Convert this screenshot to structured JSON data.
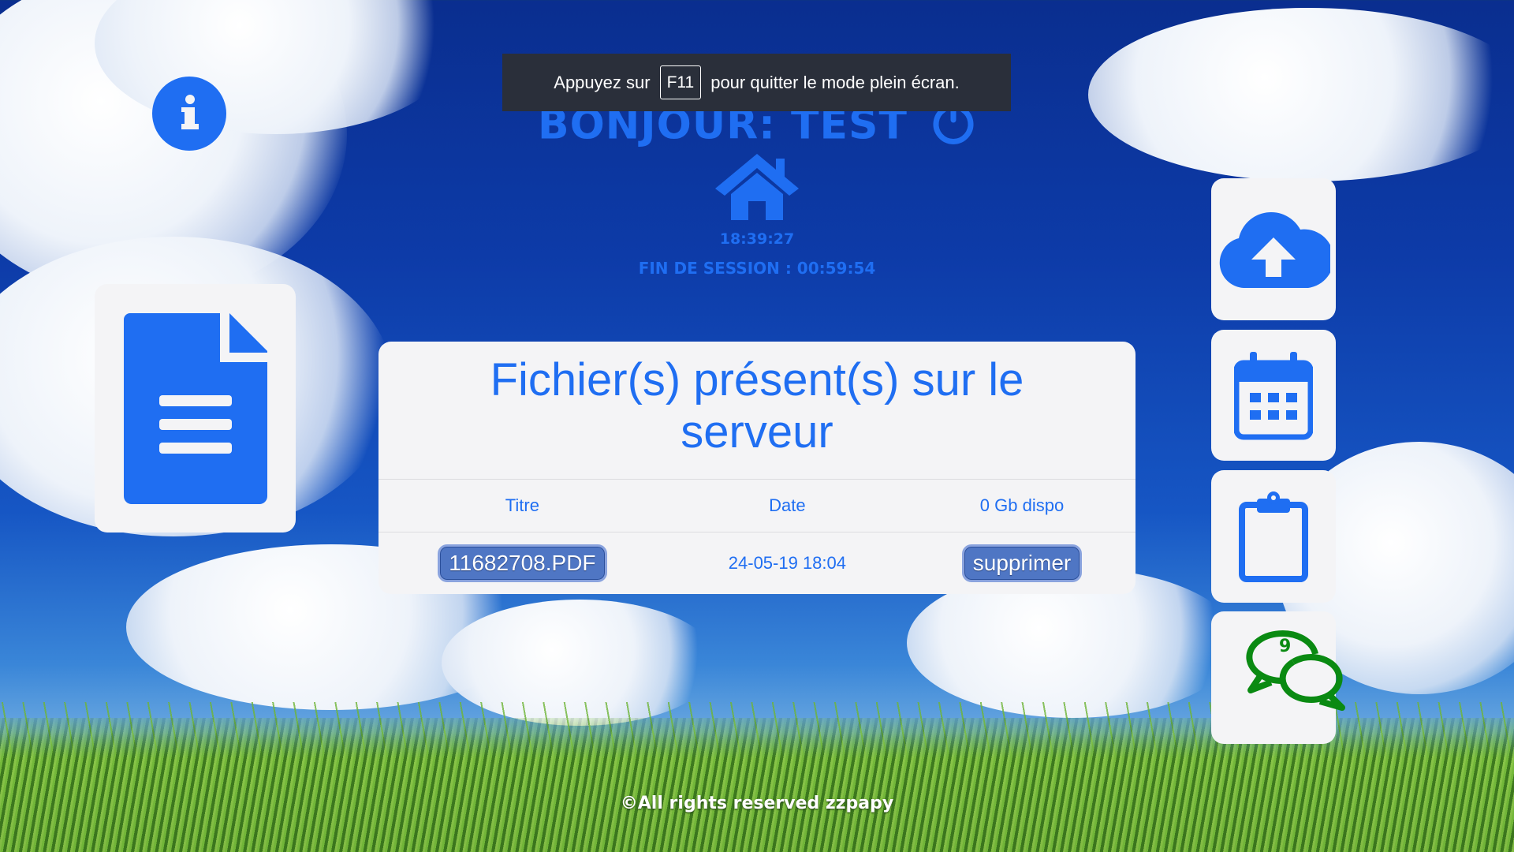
{
  "fullscreen_banner": {
    "prefix": "Appuyez sur",
    "key": "F11",
    "suffix": "pour quitter le mode plein écran."
  },
  "header": {
    "greeting": "BONJOUR: TEST",
    "clock": "18:39:27",
    "session": "FIN DE SESSION : 00:59:54"
  },
  "files": {
    "title": "Fichier(s) présent(s) sur le serveur",
    "columns": [
      "Titre",
      "Date",
      "0 Gb dispo"
    ],
    "rows": [
      {
        "name": "11682708.PDF",
        "date": "24-05-19 18:04",
        "action": "supprimer"
      }
    ]
  },
  "sidebar": {
    "chat_count": "9"
  },
  "footer": {
    "copyright": "©All rights reserved zzpapy"
  },
  "colors": {
    "accent": "#1f6ef2",
    "chat": "#0a8a12",
    "card": "#f4f4f6"
  },
  "icons": [
    "info-icon",
    "power-icon",
    "home-icon",
    "document-icon",
    "cloud-upload-icon",
    "calendar-icon",
    "clipboard-icon",
    "chat-icon"
  ]
}
